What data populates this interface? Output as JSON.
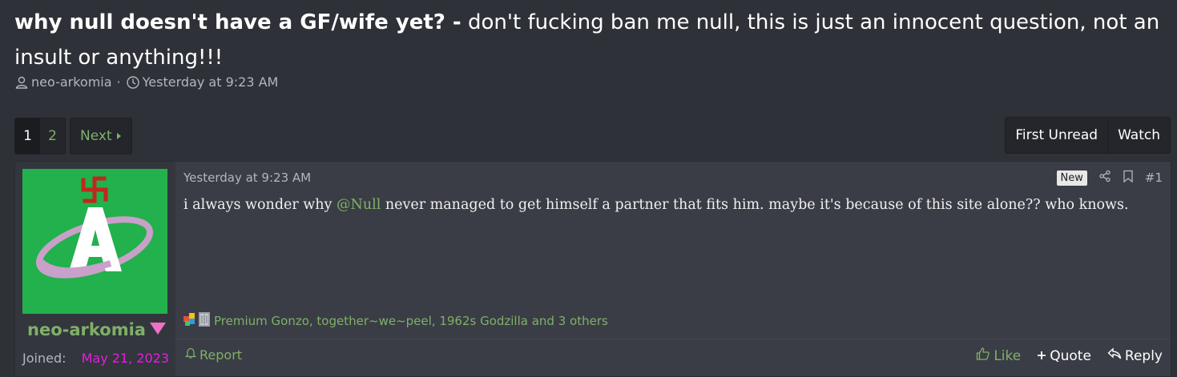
{
  "thread": {
    "title_bold": "why null doesn't have a GF/wife yet? -",
    "title_rest": " don't fucking ban me null, this is just an innocent question, not an insult or anything!!!",
    "author": "neo-arkomia",
    "separator": "·",
    "date": "Yesterday at 9:23 AM"
  },
  "pager": {
    "pages": [
      "1",
      "2"
    ],
    "current": "1",
    "next_label": "Next"
  },
  "thread_actions": {
    "first_unread": "First Unread",
    "watch": "Watch"
  },
  "post": {
    "user": {
      "name": "neo-arkomia",
      "joined_label": "Joined:",
      "joined_value": "May 21, 2023"
    },
    "date": "Yesterday at 9:23 AM",
    "new_badge": "New",
    "number": "#1",
    "text_before": "i always wonder why ",
    "mention": "@Null",
    "text_after": " never managed to get himself a partner that fits him. maybe it's because of this site alone?? who knows.",
    "reactions_text": "Premium Gonzo, together~we~peel, 1962s Godzilla and 3 others",
    "report": "Report",
    "like": "Like",
    "quote": "Quote",
    "reply": "Reply"
  },
  "colors": {
    "accent_green": "#7fb069",
    "avatar_bg": "#22b14c",
    "joined_date": "#e020e0",
    "background": "#2e3138"
  }
}
